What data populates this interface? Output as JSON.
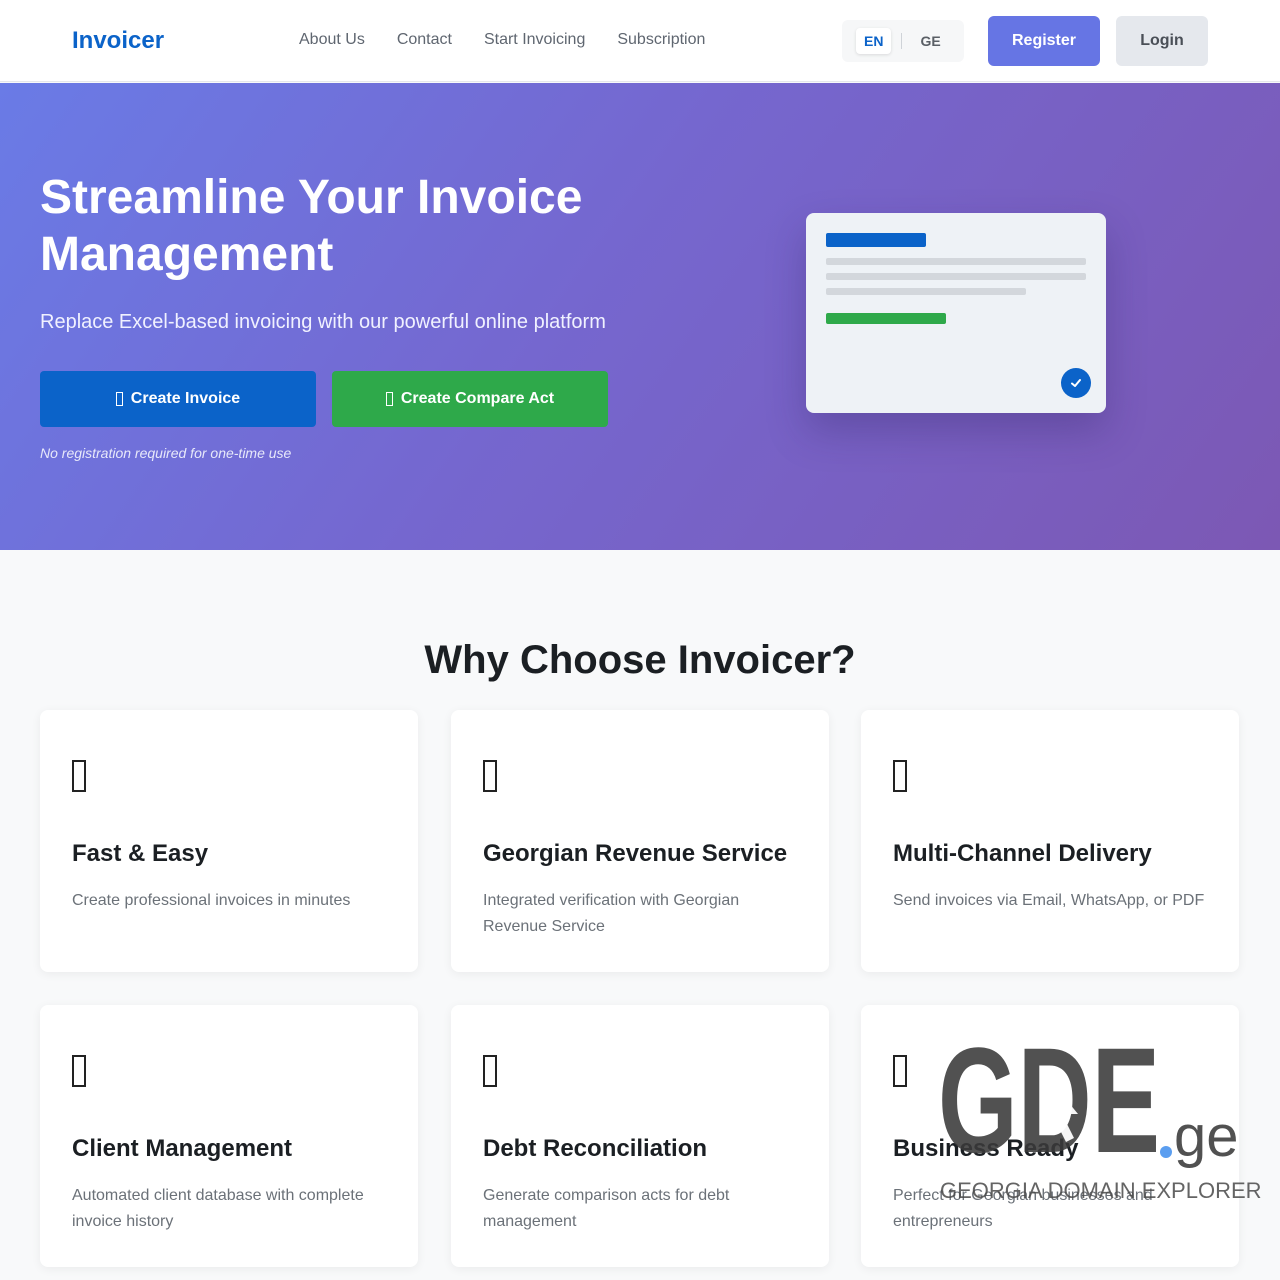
{
  "header": {
    "logo": "Invoicer",
    "nav": [
      "About Us",
      "Contact",
      "Start Invoicing",
      "Subscription"
    ],
    "languages": [
      "EN",
      "GE"
    ],
    "active_language": "EN",
    "register_label": "Register",
    "login_label": "Login"
  },
  "hero": {
    "title": "Streamline Your Invoice Management",
    "subtitle": "Replace Excel-based invoicing with our powerful online platform",
    "create_invoice_label": "Create Invoice",
    "create_compare_label": "Create Compare Act",
    "note": "No registration required for one-time use"
  },
  "features": {
    "title": "Why Choose Invoicer?",
    "items": [
      {
        "title": "Fast & Easy",
        "desc": "Create professional invoices in minutes"
      },
      {
        "title": "Georgian Revenue Service",
        "desc": "Integrated verification with Georgian Revenue Service"
      },
      {
        "title": "Multi-Channel Delivery",
        "desc": "Send invoices via Email, WhatsApp, or PDF"
      },
      {
        "title": "Client Management",
        "desc": "Automated client database with complete invoice history"
      },
      {
        "title": "Debt Reconciliation",
        "desc": "Generate comparison acts for debt management"
      },
      {
        "title": "Business Ready",
        "desc": "Perfect for Georgian businesses and entrepreneurs"
      }
    ]
  },
  "watermark": {
    "logo_text": "GDE",
    "logo_suffix": ".ge",
    "tagline": "GEORGIA DOMAIN EXPLORER"
  },
  "colors": {
    "brand": "#0b63c9",
    "green": "#2ea94a",
    "register": "#6675e4",
    "hero_gradient_start": "#6a7be6",
    "hero_gradient_end": "#7c58b4"
  }
}
